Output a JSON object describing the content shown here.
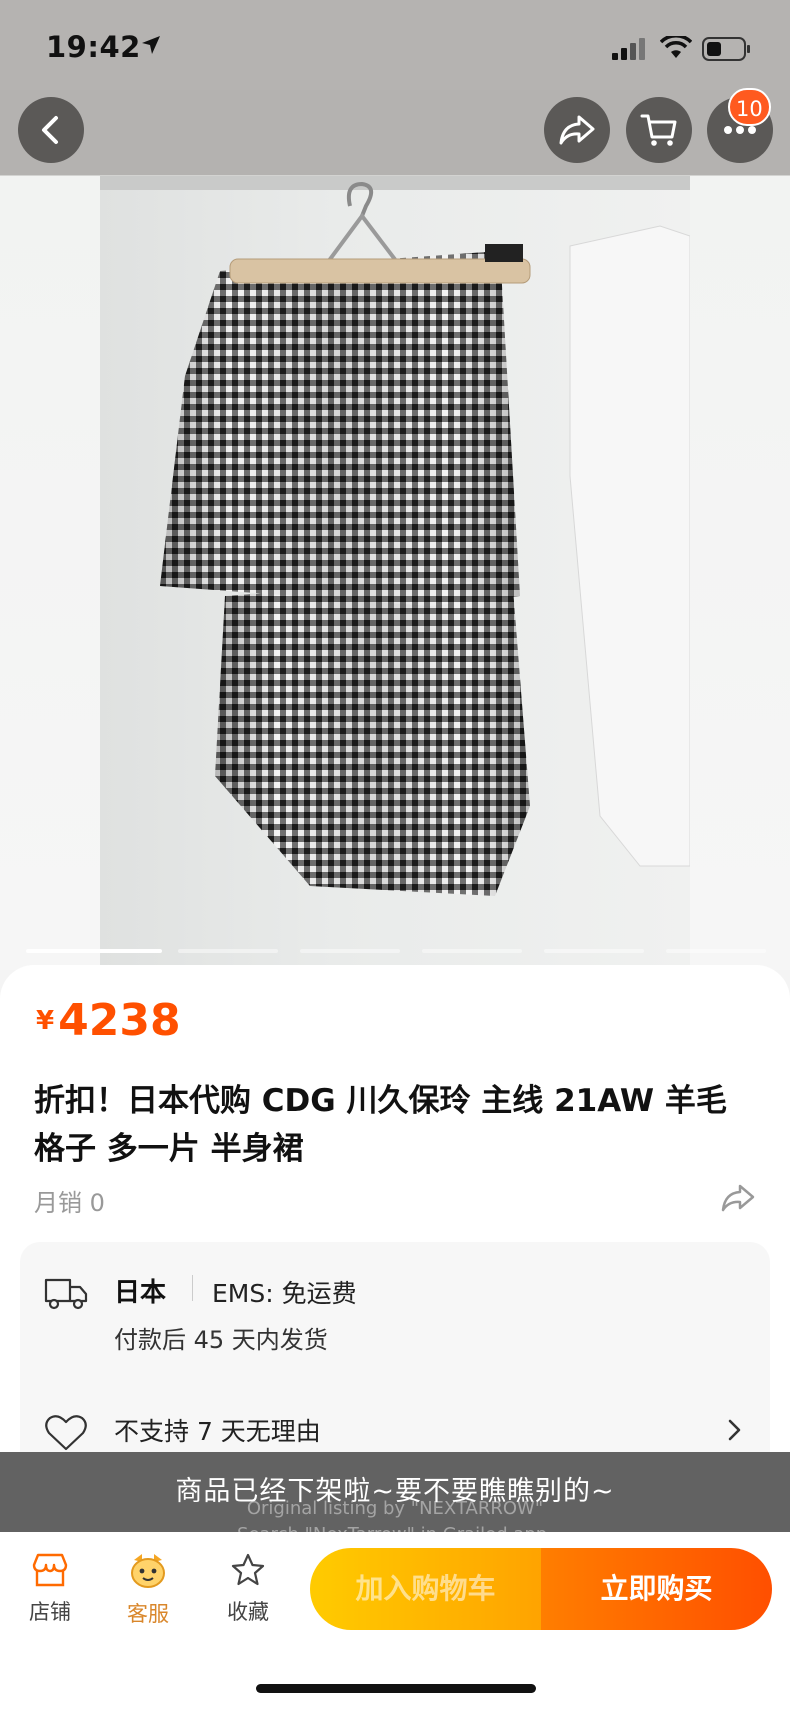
{
  "status_bar": {
    "time": "19:42"
  },
  "nav": {
    "cart_badge": "10"
  },
  "price": {
    "symbol": "¥",
    "value": "4238"
  },
  "title": "折扣！日本代购 CDG 川久保玲 主线 21AW 羊毛格子 多一片 半身裙",
  "sales": "月销 0",
  "shipping": {
    "origin": "日本",
    "method": "EMS:  免运费",
    "dispatch_time": "付款后 45 天内发货"
  },
  "return_policy": "不支持 7 天无理由",
  "toast": "商品已经下架啦~要不要瞧瞧别的~",
  "watermark": {
    "line1": "Original listing by \"NEXTARROW\"",
    "line2": "Search \"NexTarrow\" in Grailed app."
  },
  "bottom_bar": {
    "store_label": "店铺",
    "service_label": "客服",
    "favorite_label": "收藏",
    "add_to_cart_label": "加入购物车",
    "buy_now_label": "立即购买"
  },
  "colors": {
    "accent": "#ff5000",
    "cart_button": "#ffb400",
    "buy_button": "#ff5a00"
  }
}
